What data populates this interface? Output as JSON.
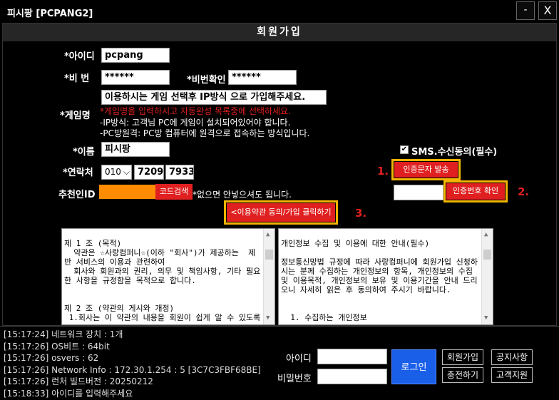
{
  "window": {
    "title": "피시팡 [PCPANG2]",
    "minimize_label": "-",
    "close_label": "X"
  },
  "form": {
    "header": "회원가입",
    "id_label": "*아이디",
    "id_value": "pcpang",
    "pw_label": "*비 번",
    "pw_value": "******",
    "pw_confirm_label": "*비번확인",
    "pw_confirm_value": "******",
    "game_label": "*게임명",
    "game_value": "이용하시는 게임 선택후 IP방식 으로 가입해주세요.",
    "game_note_red": "*게임명을 입력하시고 자동완성 목록중에 선택하세요.",
    "game_note_1": "-IP방식: 고객님 PC에 게임이 설치되어있어야 합니다.",
    "game_note_2": "-PC방원격: PC방 컴퓨터에 원격으로 접속하는 방식입니다.",
    "name_label": "*이름",
    "name_value": "피시팡",
    "phone_label": "*연락처",
    "phone_prefix": "010",
    "phone_mid": "7209",
    "phone_last": "7933",
    "referrer_label": "추천인ID",
    "code_search_label": "코드검색",
    "referrer_note": "*없으면 안넣으셔도 됩니다.",
    "sms_label": "SMS.수신동의(필수)",
    "sms_checked": true,
    "send_code_label": "인증문자 발송",
    "verify_code_label": "인증번호 확인",
    "agree_label": "<이용약관 동의/가입 클릭하기",
    "step1": "1.",
    "step2": "2.",
    "step3": "3."
  },
  "terms_text": "제 1 조 (목적)\n  약관은 ☆사랑컴퍼니☆(이하 \"회사\")가 제공하는  제반 서비스의 이용과 관련하여\n  회사와 회원과의 권리, 의무 및 책임사항, 기타 필요한 사항을 규정함을 목적으로 합니다.\n\n\n제 2 조 (약관의 게시와 개정)\n 1.회사는 이 약관의 내용을 회원이 쉽게 알 수 있도록",
  "privacy_text": "개인정보 수집 및 이용에 대한 안내(필수)\n\n정보통신망법 규정에 따라 사랑컴퍼니에 회원가입 신청하시는 분께 수집하는 개인정보의 항목, 개인정보의 수집 및 이용목적, 개인정보의 보유 및 이용기간을 안내 드리오니 자세히 읽은 후 동의하여 주시기 바랍니다.\n\n\n  1. 수집하는 개인정보",
  "log": [
    "[15:17:24] 네트워크 장치 : 1개",
    "[15:17:26] OS비트 : 64bit",
    "[15:17:26] osvers : 62",
    "[15:17:26] Network Info : 172.30.1.254 : 5 [3C7C3FBF68BE]",
    "[15:17:26] 런처 빌드버전 : 20250212",
    "[15:18:33] 아이디를 입력해주세요"
  ],
  "login": {
    "id_label": "아이디",
    "pw_label": "비밀번호",
    "login_button": "로그인",
    "join_button": "회원가입",
    "notice_button": "공지사항",
    "charge_button": "충전하기",
    "support_button": "고객지원"
  }
}
